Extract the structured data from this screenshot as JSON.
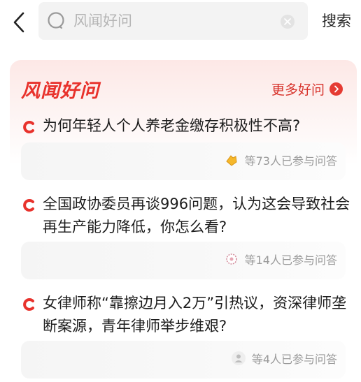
{
  "header": {
    "search_placeholder": "风闻好问",
    "search_label": "搜索"
  },
  "section": {
    "title": "风闻好问",
    "more_label": "更多好问"
  },
  "questions": [
    {
      "title": "为何年轻人个人养老金缴存积极性不高?",
      "participants": "等73人已参与问答",
      "avatar": "yellow-thumbs-avatar-icon"
    },
    {
      "title": "全国政协委员再谈996问题，认为这会导致社会再生产能力降低，你怎么看?",
      "participants": "等14人已参与问答",
      "avatar": "pink-floral-avatar-icon"
    },
    {
      "title": "女律师称“靠擦边月入2万”引热议，资深律师垄断案源，青年律师举步维艰?",
      "participants": "等4人已参与问答",
      "avatar": "gray-person-avatar-icon"
    }
  ],
  "colors": {
    "accent": "#e8322c",
    "more": "#d7322b",
    "muted": "#9a9a9a",
    "search_bg": "#f3f3f3"
  }
}
